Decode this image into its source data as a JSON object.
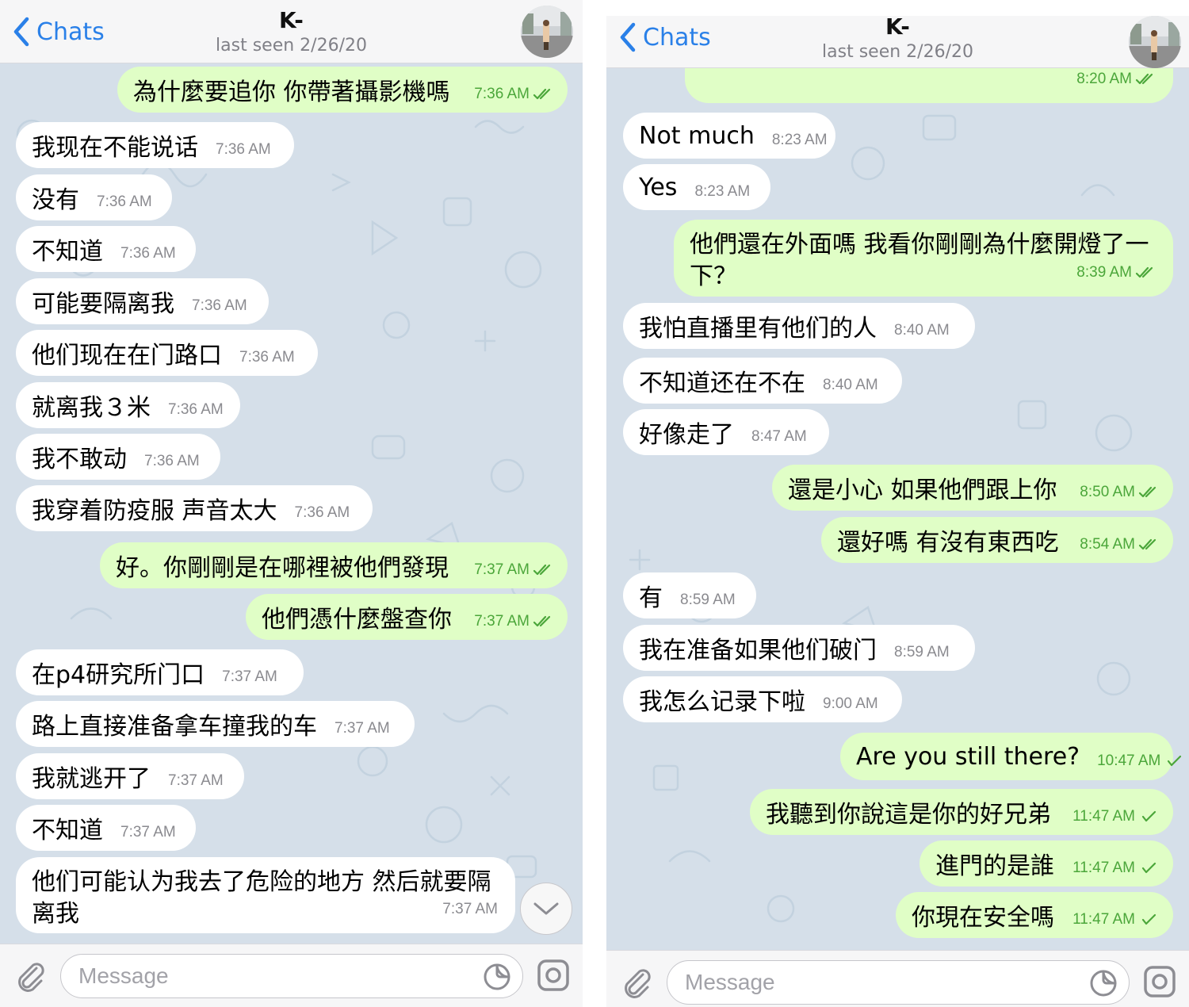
{
  "colors": {
    "accent": "#2a80e8",
    "outgoing_bubble": "#e0fec6",
    "incoming_bubble": "#ffffff",
    "chat_background": "#d5dfe9",
    "tick_color": "#4ba63a"
  },
  "screens": [
    {
      "header": {
        "back_label": "Chats",
        "title": "K-",
        "status": "last seen 2/26/20"
      },
      "input": {
        "placeholder": "Message"
      },
      "messages": [
        {
          "text": "為什麼要追你 你帶著攝影機嗎",
          "time": "7:36 AM",
          "dir": "out",
          "ticks": "double"
        },
        {
          "text": "我现在不能说话",
          "time": "7:36 AM",
          "dir": "in"
        },
        {
          "text": "没有",
          "time": "7:36 AM",
          "dir": "in"
        },
        {
          "text": "不知道",
          "time": "7:36 AM",
          "dir": "in"
        },
        {
          "text": "可能要隔离我",
          "time": "7:36 AM",
          "dir": "in"
        },
        {
          "text": "他们现在在门路口",
          "time": "7:36 AM",
          "dir": "in"
        },
        {
          "text": "就离我３米",
          "time": "7:36 AM",
          "dir": "in"
        },
        {
          "text": "我不敢动",
          "time": "7:36 AM",
          "dir": "in"
        },
        {
          "text": "我穿着防疫服 声音太大",
          "time": "7:36 AM",
          "dir": "in"
        },
        {
          "text": "好。你剛剛是在哪裡被他們發現",
          "time": "7:37 AM",
          "dir": "out",
          "ticks": "double"
        },
        {
          "text": "他們憑什麼盤查你",
          "time": "7:37 AM",
          "dir": "out",
          "ticks": "double"
        },
        {
          "text": "在p4研究所门口",
          "time": "7:37 AM",
          "dir": "in"
        },
        {
          "text": "路上直接准备拿车撞我的车",
          "time": "7:37 AM",
          "dir": "in"
        },
        {
          "text": "我就逃开了",
          "time": "7:37 AM",
          "dir": "in"
        },
        {
          "text": "不知道",
          "time": "7:37 AM",
          "dir": "in"
        },
        {
          "text": "他们可能认为我去了危险的地方 然后就要隔离我",
          "time": "7:37 AM",
          "dir": "in"
        }
      ]
    },
    {
      "header": {
        "back_label": "Chats",
        "title": "K-",
        "status": "last seen 2/26/20"
      },
      "input": {
        "placeholder": "Message"
      },
      "messages": [
        {
          "text": "",
          "time": "8:20 AM",
          "dir": "out",
          "ticks": "double"
        },
        {
          "text": "Not much",
          "time": "8:23 AM",
          "dir": "in"
        },
        {
          "text": "Yes",
          "time": "8:23 AM",
          "dir": "in"
        },
        {
          "text": "他們還在外面嗎 我看你剛剛為什麼開燈了一下？",
          "time": "8:39 AM",
          "dir": "out",
          "ticks": "double"
        },
        {
          "text": "我怕直播里有他们的人",
          "time": "8:40 AM",
          "dir": "in"
        },
        {
          "text": "不知道还在不在",
          "time": "8:40 AM",
          "dir": "in"
        },
        {
          "text": "好像走了",
          "time": "8:47 AM",
          "dir": "in"
        },
        {
          "text": "還是小心 如果他們跟上你",
          "time": "8:50 AM",
          "dir": "out",
          "ticks": "double"
        },
        {
          "text": "還好嗎 有沒有東西吃",
          "time": "8:54 AM",
          "dir": "out",
          "ticks": "double"
        },
        {
          "text": "有",
          "time": "8:59 AM",
          "dir": "in"
        },
        {
          "text": "我在准备如果他们破门",
          "time": "8:59 AM",
          "dir": "in"
        },
        {
          "text": "我怎么记录下啦",
          "time": "9:00 AM",
          "dir": "in"
        },
        {
          "text": "Are you still there?",
          "time": "10:47 AM",
          "dir": "out",
          "ticks": "single"
        },
        {
          "text": "我聽到你說這是你的好兄弟",
          "time": "11:47 AM",
          "dir": "out",
          "ticks": "single"
        },
        {
          "text": "進門的是誰",
          "time": "11:47 AM",
          "dir": "out",
          "ticks": "single"
        },
        {
          "text": "你現在安全嗎",
          "time": "11:47 AM",
          "dir": "out",
          "ticks": "single"
        }
      ]
    }
  ]
}
